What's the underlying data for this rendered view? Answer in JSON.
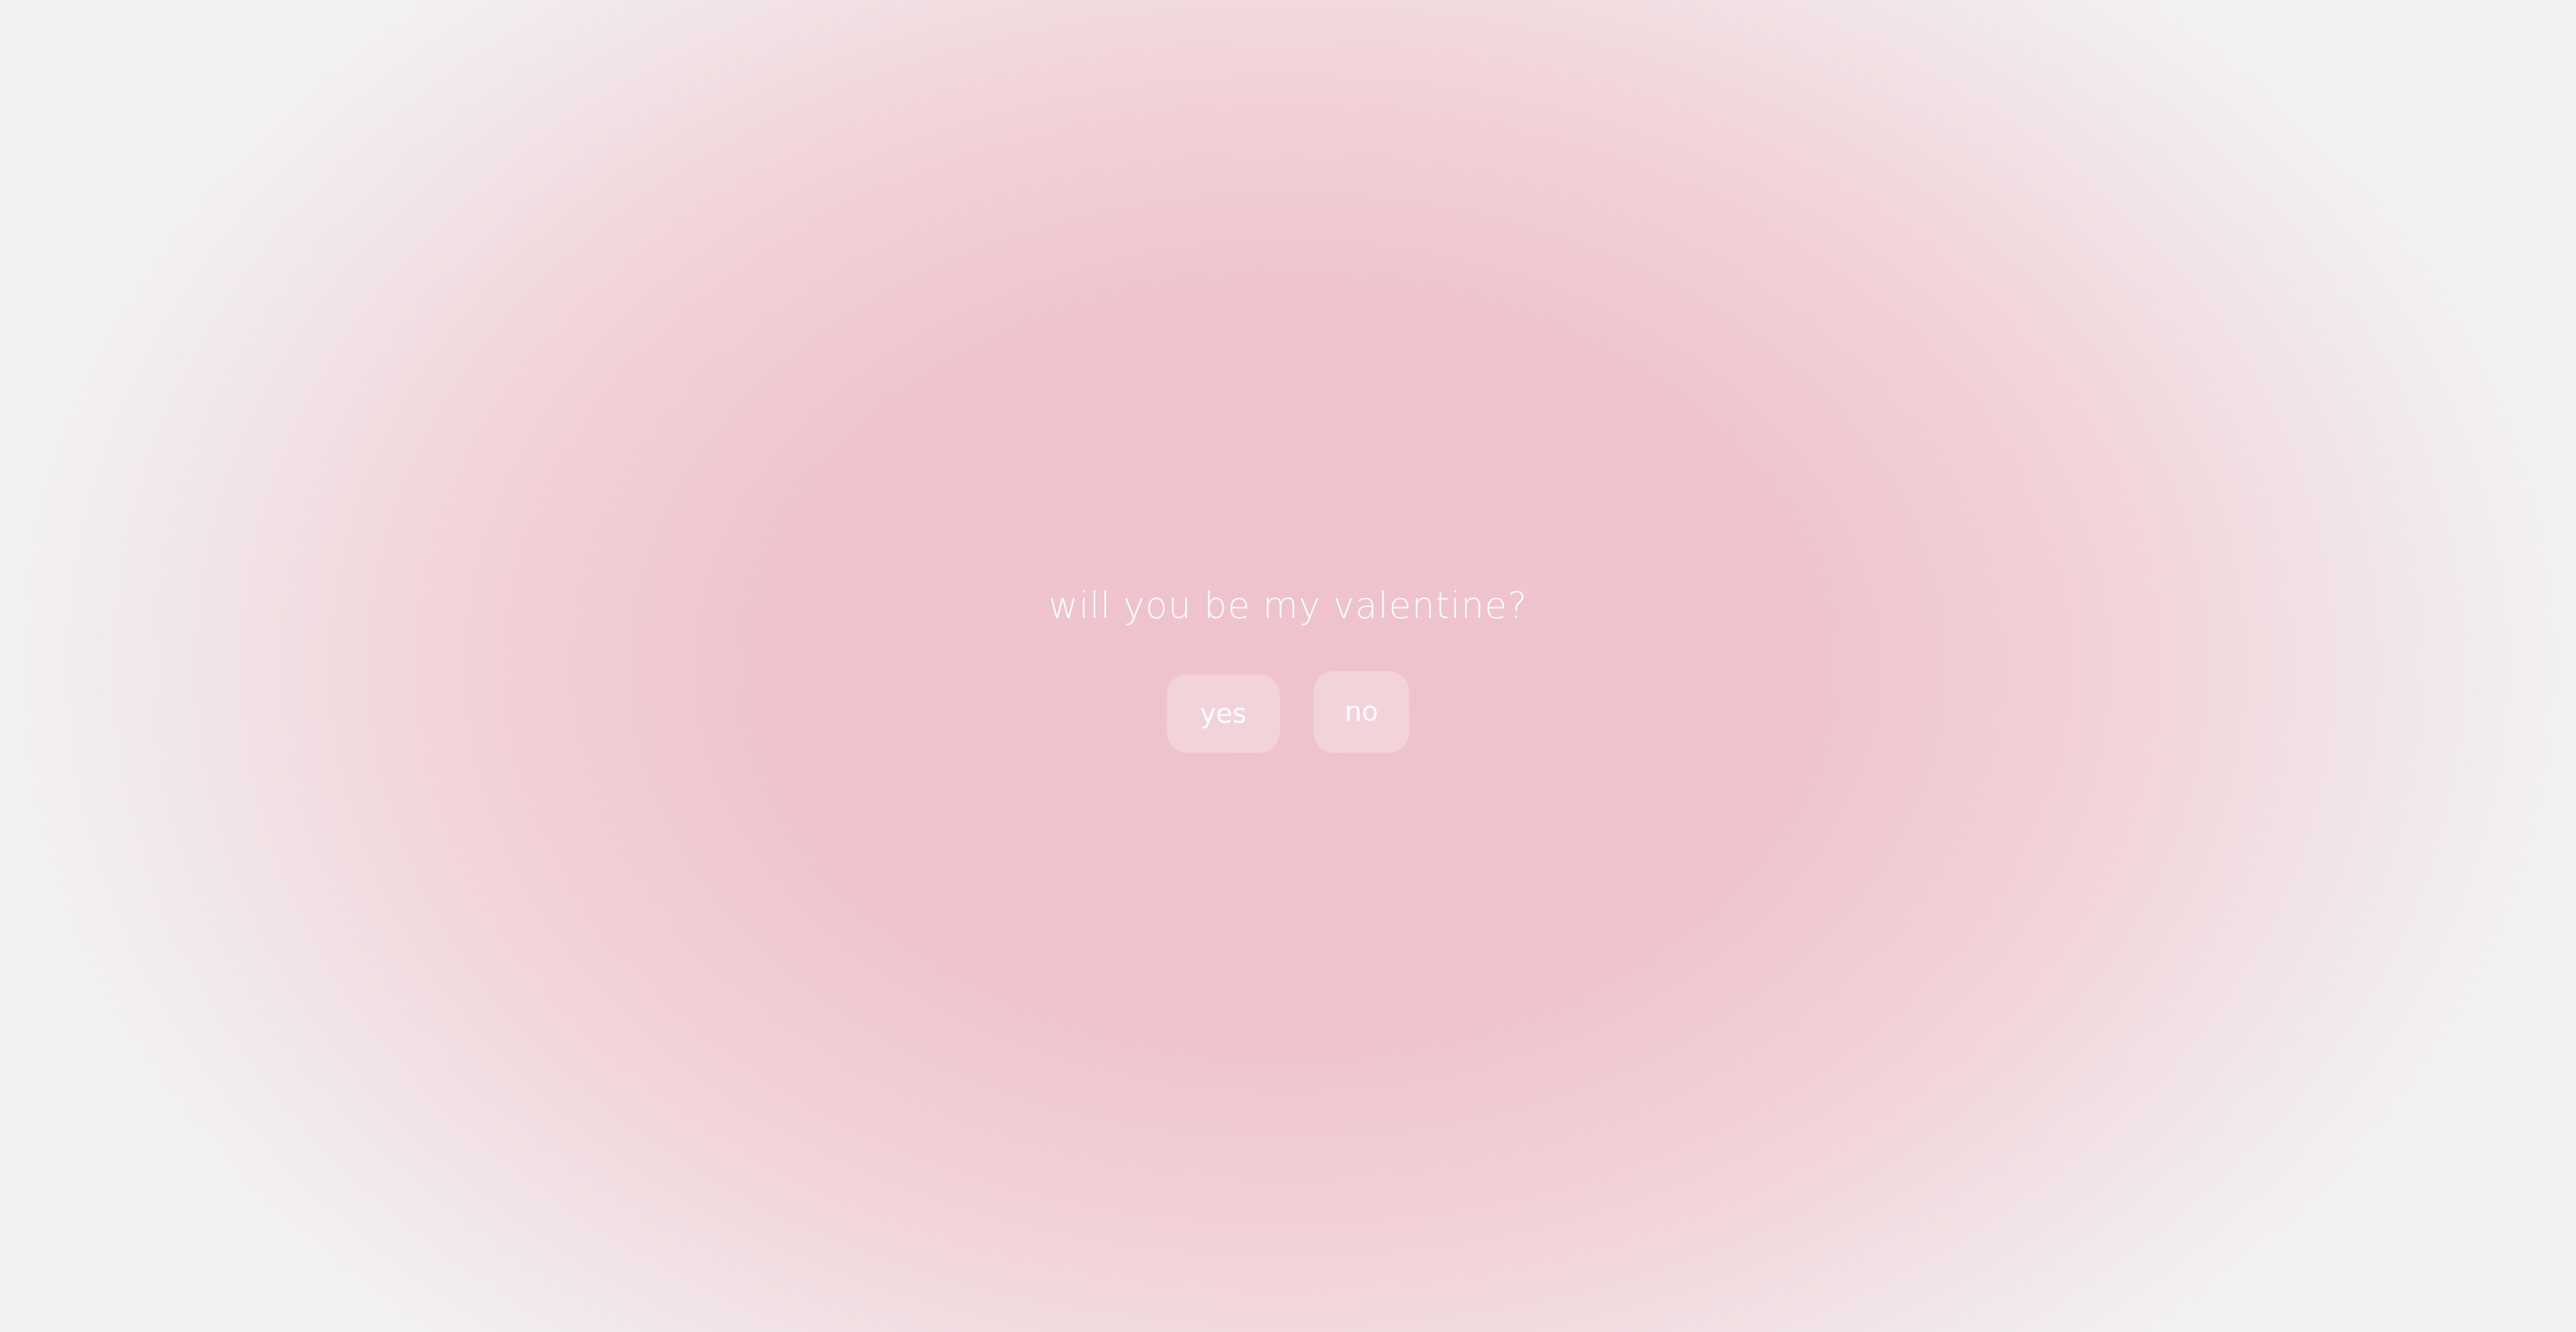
{
  "prompt": {
    "question": "will you be my valentine?"
  },
  "buttons": {
    "yes_label": "yes",
    "no_label": "no"
  },
  "colors": {
    "background_center": "#efc3cc",
    "background_edge": "#f2f2f2",
    "text": "#ffffff",
    "button_fill": "rgba(255,255,255,0.28)"
  }
}
